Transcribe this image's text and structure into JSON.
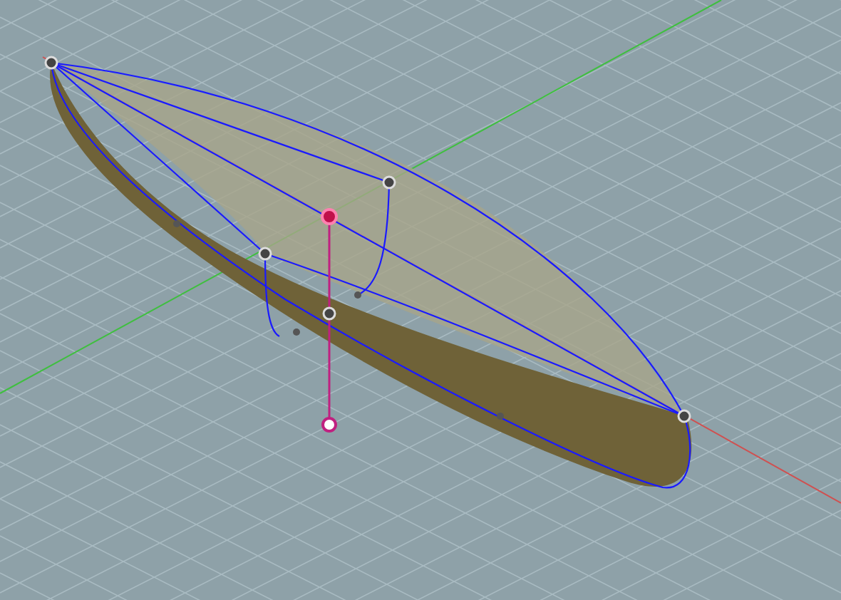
{
  "control_points": [
    {
      "kind": "major",
      "selected": false
    },
    {
      "kind": "major",
      "selected": false
    },
    {
      "kind": "major",
      "selected": false
    },
    {
      "kind": "major",
      "selected": true
    },
    {
      "kind": "major",
      "selected": false
    },
    {
      "kind": "major",
      "selected": false
    },
    {
      "kind": "minor",
      "selected": false
    },
    {
      "kind": "minor",
      "selected": false
    },
    {
      "kind": "minor",
      "selected": false
    },
    {
      "kind": "minor",
      "selected": false
    }
  ]
}
